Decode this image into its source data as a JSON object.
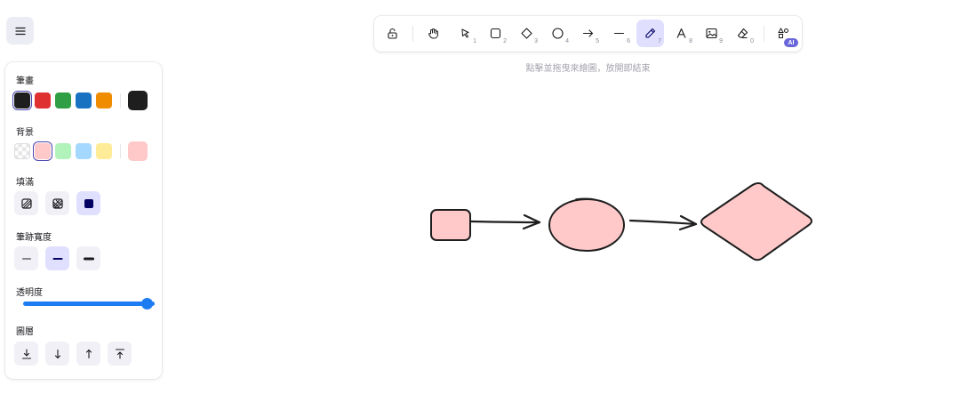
{
  "panel": {
    "stroke": {
      "label": "筆畫",
      "colors": [
        "#1e1e1e",
        "#e03131",
        "#2f9e44",
        "#1971c2",
        "#f08c00"
      ],
      "selected": 0,
      "current": "#1e1e1e"
    },
    "background": {
      "label": "背景",
      "colors": [
        "transparent",
        "#ffc9c9",
        "#b2f2bb",
        "#a5d8ff",
        "#ffec99"
      ],
      "selected": 1,
      "current": "#ffc9c9"
    },
    "fill": {
      "label": "填滿",
      "options": [
        "hachure-fill-icon",
        "cross-hatch-fill-icon",
        "solid-fill-icon"
      ],
      "selected": 2
    },
    "stroke_width": {
      "label": "筆跡寬度",
      "options": [
        "thin",
        "bold",
        "extra-bold"
      ],
      "selected": 1
    },
    "opacity": {
      "label": "透明度",
      "value": 100
    },
    "layers": {
      "label": "圖層",
      "actions": [
        "send-to-back-icon",
        "send-backward-icon",
        "bring-forward-icon",
        "bring-to-front-icon"
      ]
    }
  },
  "toolbar": {
    "tools": [
      {
        "name": "lock",
        "key": ""
      },
      {
        "name": "hand",
        "key": ""
      },
      {
        "name": "selection",
        "key": "1"
      },
      {
        "name": "rectangle",
        "key": "2"
      },
      {
        "name": "diamond",
        "key": "3"
      },
      {
        "name": "ellipse",
        "key": "4"
      },
      {
        "name": "arrow",
        "key": "5"
      },
      {
        "name": "line",
        "key": "6"
      },
      {
        "name": "pencil",
        "key": "7"
      },
      {
        "name": "text",
        "key": "8"
      },
      {
        "name": "image",
        "key": "9"
      },
      {
        "name": "eraser",
        "key": "0"
      },
      {
        "name": "more-shapes",
        "key": ""
      }
    ],
    "active_tool": "pencil",
    "ai_badge": "AI"
  },
  "hint": "點擊並拖曳來繪圖，放開即結束",
  "colors": {
    "accent": "#6965db",
    "active_bg": "#e0dffe",
    "shape_fill": "#ffc9c9",
    "shape_stroke": "#1e1e1e"
  }
}
